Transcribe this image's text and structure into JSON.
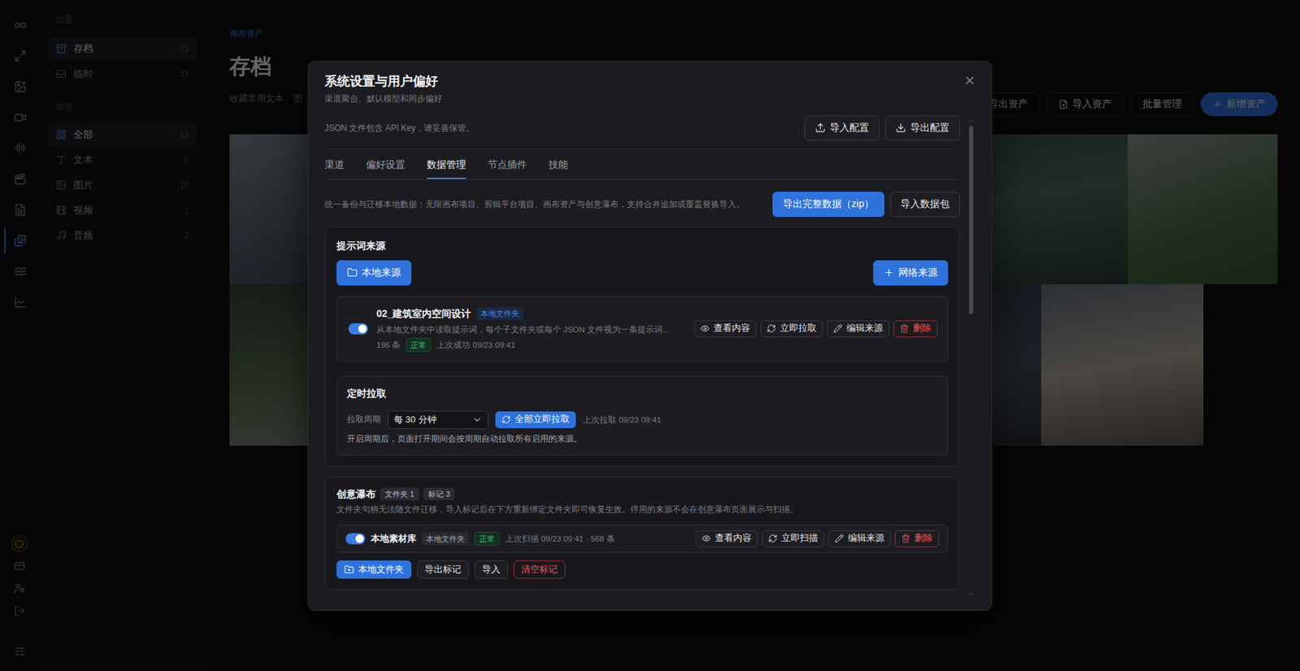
{
  "rail": [
    {
      "selected": false
    },
    {
      "selected": false
    },
    {
      "selected": false
    },
    {
      "selected": false
    },
    {
      "selected": false
    },
    {
      "selected": false
    },
    {
      "selected": false
    },
    {
      "selected": true
    },
    {
      "selected": false
    },
    {
      "selected": false
    }
  ],
  "sidebar": {
    "sections": [
      {
        "label": "位置",
        "items": [
          {
            "label": "存档",
            "count": "13",
            "selected": true
          },
          {
            "label": "临时",
            "count": "27",
            "selected": false
          }
        ]
      },
      {
        "label": "类型",
        "items": [
          {
            "label": "全部",
            "count": "13",
            "selected": true
          },
          {
            "label": "文本",
            "count": "0",
            "selected": false
          },
          {
            "label": "图片",
            "count": "10",
            "selected": false
          },
          {
            "label": "视频",
            "count": "1",
            "selected": false
          },
          {
            "label": "音频",
            "count": "2",
            "selected": false
          }
        ]
      }
    ]
  },
  "page": {
    "breadcrumb": "画布资产",
    "title": "存档",
    "subtitle": "收藏常用文本、图",
    "actions": [
      {
        "label": "导出资产",
        "kind": "outline"
      },
      {
        "label": "导入资产",
        "kind": "outline"
      },
      {
        "label": "批量管理",
        "kind": "outline"
      },
      {
        "label": "新增资产",
        "kind": "primary"
      }
    ]
  },
  "dialog": {
    "title": "系统设置与用户偏好",
    "subtitle": "渠道聚合、默认模型和同步偏好",
    "config_note": "JSON 文件包含 API Key，请妥善保管。",
    "config_buttons": [
      "导入配置",
      "导出配置"
    ],
    "tabs": [
      {
        "label": "渠道",
        "selected": false
      },
      {
        "label": "偏好设置",
        "selected": false
      },
      {
        "label": "数据管理",
        "selected": true
      },
      {
        "label": "节点插件",
        "selected": false
      },
      {
        "label": "技能",
        "selected": false
      }
    ],
    "backup": {
      "description": "统一备份与迁移本地数据：无限画布项目、剪辑平台项目、画布资产与创意瀑布，支持合并追加或覆盖替换导入。",
      "buttons": [
        {
          "label": "导出完整数据（zip）",
          "kind": "primary"
        },
        {
          "label": "导入数据包",
          "kind": "outline"
        }
      ]
    },
    "prompt_sources": {
      "title": "提示词来源",
      "add_buttons": [
        {
          "label": "本地来源",
          "kind": "primary"
        },
        {
          "label": "网络来源",
          "kind": "primary"
        }
      ],
      "sources": [
        {
          "name": "02_建筑室内空间设计",
          "tag": "本地文件夹",
          "description": "从本地文件夹中读取提示词，每个子文件夹或每个 JSON 文件视为一条提示词...",
          "count": "196 条",
          "status": "正常",
          "last": "上次成功 09/23 09:41",
          "on": true,
          "actions": [
            {
              "label": "查看内容",
              "kind": "outline"
            },
            {
              "label": "立即拉取",
              "kind": "outline"
            },
            {
              "label": "编辑来源",
              "kind": "outline"
            },
            {
              "label": "删除",
              "kind": "danger"
            }
          ]
        }
      ],
      "schedule": {
        "title": "定时拉取",
        "label": "拉取周期",
        "select": "每 30 分钟",
        "button": "全部立即拉取",
        "last": "上次拉取 09/23 09:41",
        "note": "开启周期后，页面打开期间会按周期自动拉取所有启用的来源。"
      }
    },
    "waterfall": {
      "title": "创意瀑布",
      "chips": [
        "文件夹 1",
        "标记 3"
      ],
      "description": "文件夹句柄无法随文件迁移，导入标记后在下方重新绑定文件夹即可恢复生效。停用的来源不会在创意瀑布页面展示与扫描。",
      "sources": [
        {
          "name": "本地素材库",
          "tag": "本地文件夹",
          "status": "正常",
          "meta": "上次扫描 09/23 09:41 · 568 条",
          "on": true,
          "actions": [
            {
              "label": "查看内容",
              "kind": "outline"
            },
            {
              "label": "立即扫描",
              "kind": "outline"
            },
            {
              "label": "编辑来源",
              "kind": "outline"
            },
            {
              "label": "删除",
              "kind": "danger"
            }
          ]
        }
      ],
      "buttons": [
        {
          "label": "本地文件夹",
          "kind": "primary"
        },
        {
          "label": "导出标记",
          "kind": "outline"
        },
        {
          "label": "导入",
          "kind": "outline"
        },
        {
          "label": "清空标记",
          "kind": "danger"
        }
      ]
    }
  }
}
